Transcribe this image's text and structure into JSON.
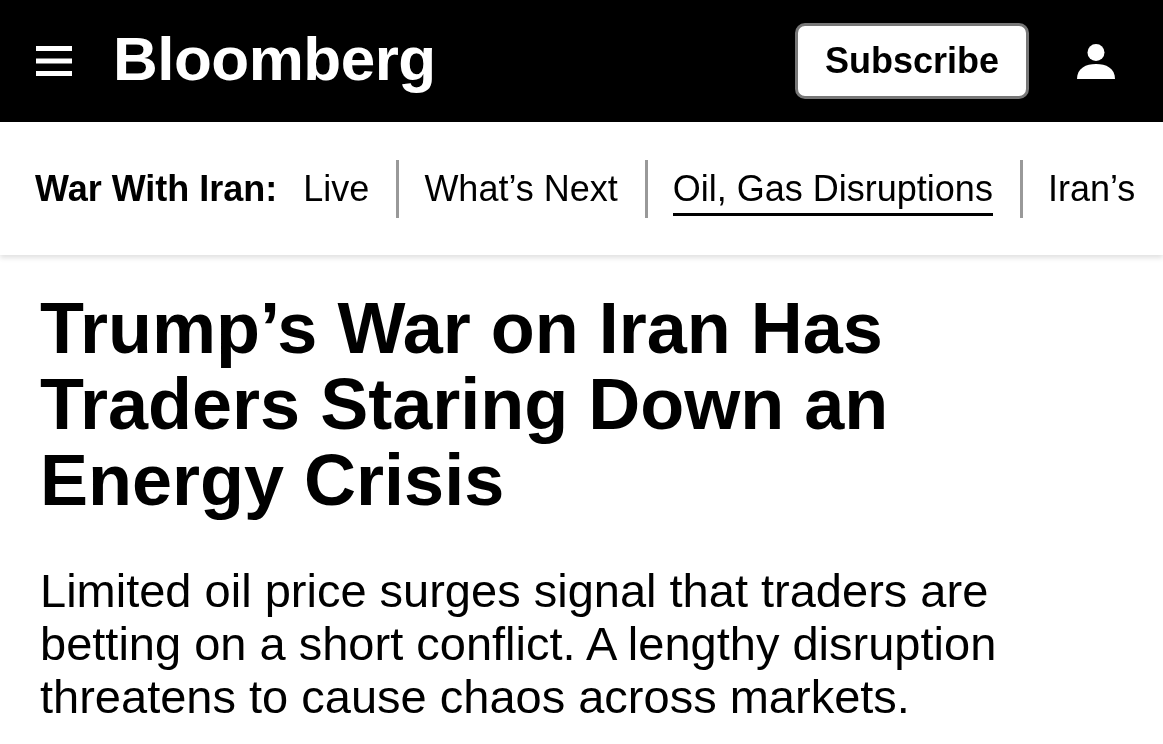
{
  "header": {
    "logo": "Bloomberg",
    "subscribe_button": "Subscribe"
  },
  "topic_bar": {
    "label": "War With Iran:",
    "links": [
      {
        "label": "Live",
        "selected": false
      },
      {
        "label": "What’s Next",
        "selected": false
      },
      {
        "label": "Oil, Gas Disruptions",
        "selected": true
      },
      {
        "label": "Iran’s",
        "selected": false
      }
    ]
  },
  "article": {
    "headline": "Trump’s War on Iran Has Traders Staring Down an Energy Crisis",
    "dek": "Limited oil price surges signal that traders are betting on a short conflict. A lengthy disruption threatens to cause chaos across markets."
  }
}
